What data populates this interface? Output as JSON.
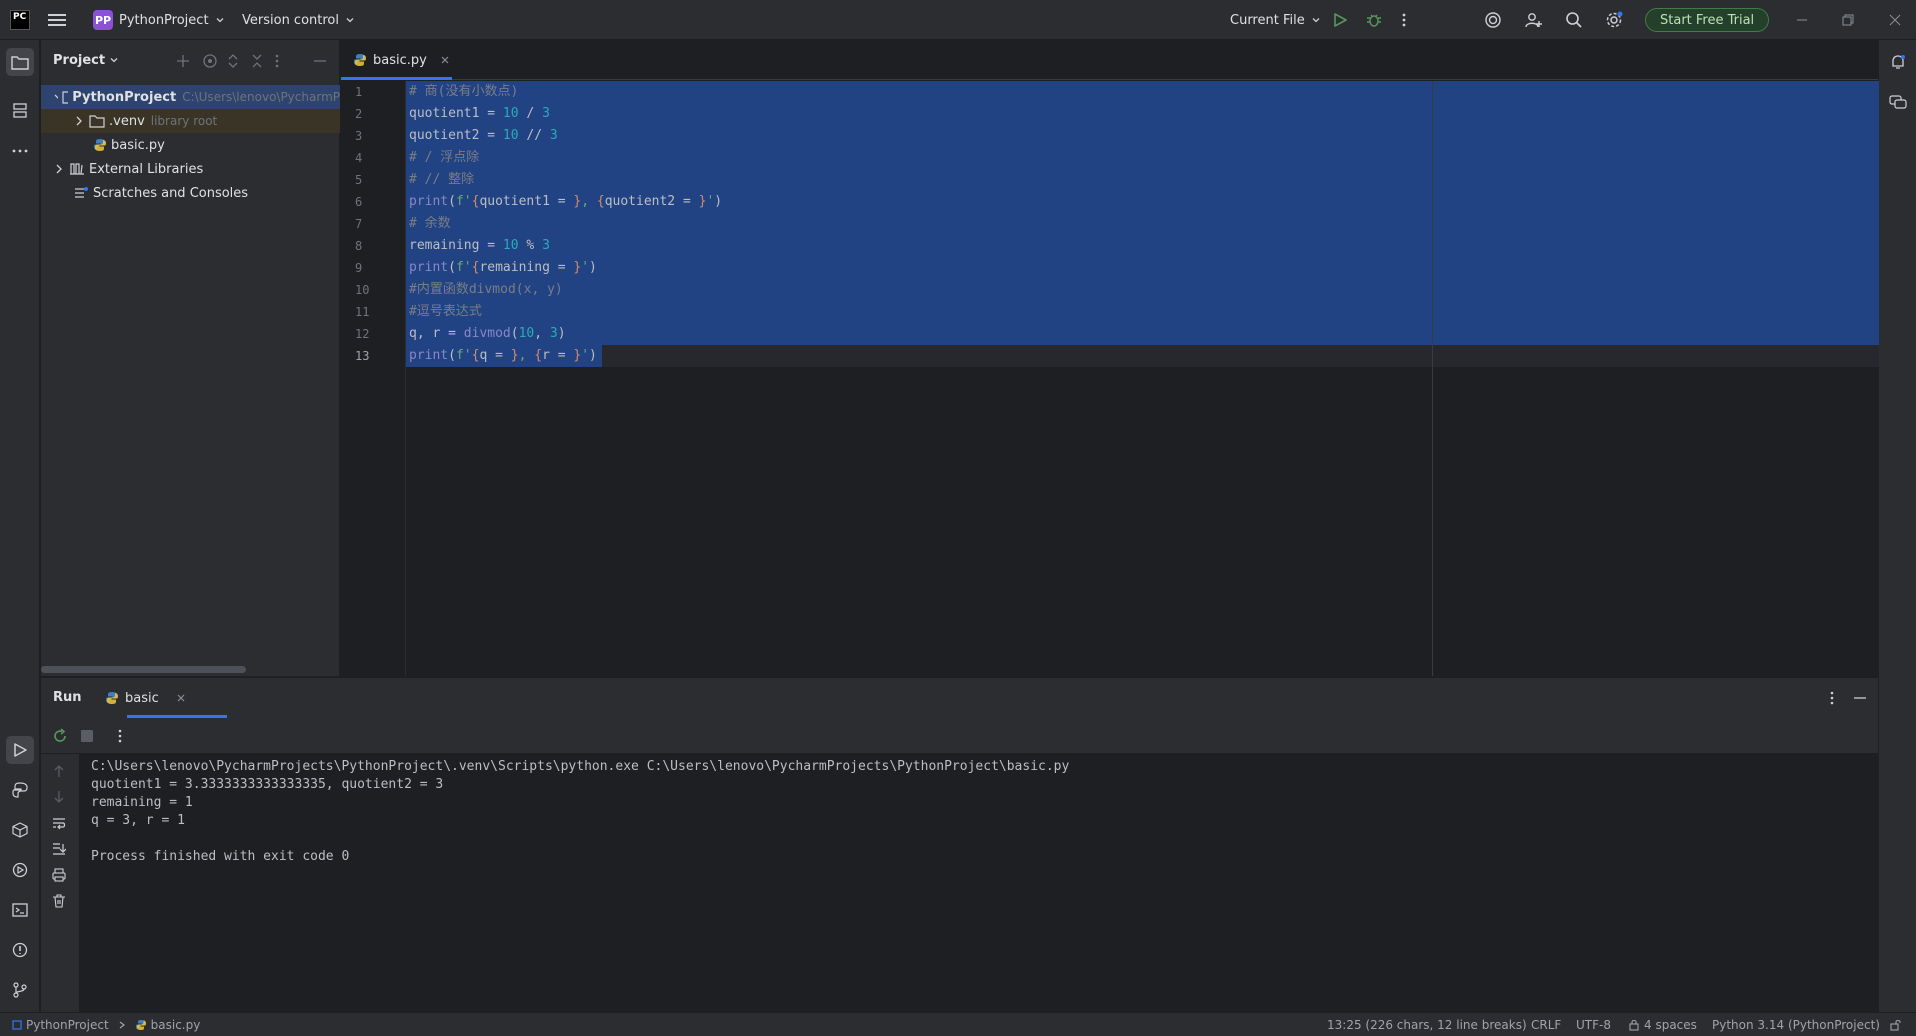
{
  "app": {
    "logo": "PC"
  },
  "titlebar": {
    "project_badge": "PP",
    "project_name": "PythonProject",
    "version_control": "Version control",
    "run_config": "Current File",
    "trial_button": "Start Free Trial"
  },
  "project_panel": {
    "title": "Project",
    "tree": [
      {
        "label": "PythonProject",
        "hint": "C:\\Users\\lenovo\\PycharmP"
      },
      {
        "label": ".venv",
        "hint": "library root"
      },
      {
        "label": "basic.py",
        "hint": ""
      },
      {
        "label": "External Libraries",
        "hint": ""
      },
      {
        "label": "Scratches and Consoles",
        "hint": ""
      }
    ]
  },
  "editor": {
    "tab": {
      "label": "basic.py"
    },
    "line_numbers": [
      "1",
      "2",
      "3",
      "4",
      "5",
      "6",
      "7",
      "8",
      "9",
      "10",
      "11",
      "12",
      "13"
    ],
    "lines": [
      [
        {
          "t": "# 商(没有小数点)",
          "c": "cm"
        }
      ],
      [
        {
          "t": "quotient1 = ",
          "c": "tx"
        },
        {
          "t": "10",
          "c": "num"
        },
        {
          "t": " / ",
          "c": "tx"
        },
        {
          "t": "3",
          "c": "num"
        }
      ],
      [
        {
          "t": "quotient2 = ",
          "c": "tx"
        },
        {
          "t": "10",
          "c": "num"
        },
        {
          "t": " // ",
          "c": "tx"
        },
        {
          "t": "3",
          "c": "num"
        }
      ],
      [
        {
          "t": "# / 浮点除",
          "c": "cm"
        }
      ],
      [
        {
          "t": "# // 整除",
          "c": "cm"
        }
      ],
      [
        {
          "t": "print",
          "c": "fn"
        },
        {
          "t": "(",
          "c": "tx"
        },
        {
          "t": "f'",
          "c": "str"
        },
        {
          "t": "{",
          "c": "brace"
        },
        {
          "t": "quotient1 = ",
          "c": "tx"
        },
        {
          "t": "}",
          "c": "brace"
        },
        {
          "t": ", ",
          "c": "str"
        },
        {
          "t": "{",
          "c": "brace"
        },
        {
          "t": "quotient2 = ",
          "c": "tx"
        },
        {
          "t": "}",
          "c": "brace"
        },
        {
          "t": "'",
          "c": "str"
        },
        {
          "t": ")",
          "c": "tx"
        }
      ],
      [
        {
          "t": "# 余数",
          "c": "cm"
        }
      ],
      [
        {
          "t": "remaining = ",
          "c": "tx"
        },
        {
          "t": "10",
          "c": "num"
        },
        {
          "t": " % ",
          "c": "tx"
        },
        {
          "t": "3",
          "c": "num"
        }
      ],
      [
        {
          "t": "print",
          "c": "fn"
        },
        {
          "t": "(",
          "c": "tx"
        },
        {
          "t": "f'",
          "c": "str"
        },
        {
          "t": "{",
          "c": "brace"
        },
        {
          "t": "remaining = ",
          "c": "tx"
        },
        {
          "t": "}",
          "c": "brace"
        },
        {
          "t": "'",
          "c": "str"
        },
        {
          "t": ")",
          "c": "tx"
        }
      ],
      [
        {
          "t": "#内置函数divmod(x, y)",
          "c": "cm"
        }
      ],
      [
        {
          "t": "#逗号表达式",
          "c": "cm"
        }
      ],
      [
        {
          "t": "q, r = ",
          "c": "tx"
        },
        {
          "t": "divmod",
          "c": "fn"
        },
        {
          "t": "(",
          "c": "tx"
        },
        {
          "t": "10",
          "c": "num"
        },
        {
          "t": ", ",
          "c": "tx"
        },
        {
          "t": "3",
          "c": "num"
        },
        {
          "t": ")",
          "c": "tx"
        }
      ],
      [
        {
          "t": "print",
          "c": "fn"
        },
        {
          "t": "(",
          "c": "tx"
        },
        {
          "t": "f'",
          "c": "str"
        },
        {
          "t": "{",
          "c": "brace"
        },
        {
          "t": "q = ",
          "c": "tx"
        },
        {
          "t": "}",
          "c": "brace"
        },
        {
          "t": ", ",
          "c": "str"
        },
        {
          "t": "{",
          "c": "brace"
        },
        {
          "t": "r = ",
          "c": "tx"
        },
        {
          "t": "}",
          "c": "brace"
        },
        {
          "t": "'",
          "c": "str"
        },
        {
          "t": ")",
          "c": "tx"
        }
      ]
    ]
  },
  "run_panel": {
    "title": "Run",
    "tab_label": "basic",
    "output": [
      "C:\\Users\\lenovo\\PycharmProjects\\PythonProject\\.venv\\Scripts\\python.exe C:\\Users\\lenovo\\PycharmProjects\\PythonProject\\basic.py",
      "quotient1 = 3.3333333333333335, quotient2 = 3",
      "remaining = 1",
      "q = 3, r = 1",
      "",
      "Process finished with exit code 0"
    ]
  },
  "statusbar": {
    "crumb_project": "PythonProject",
    "crumb_file": "basic.py",
    "position": "13:25 (226 chars, 12 line breaks)",
    "line_sep": "CRLF",
    "encoding": "UTF-8",
    "indent": "4 spaces",
    "interpreter": "Python 3.14 (PythonProject)"
  },
  "colors": {
    "accent": "#3574f0",
    "selection": "#214283",
    "trial_green": "#3e7b46",
    "badge_purple": "#8b52d6"
  }
}
